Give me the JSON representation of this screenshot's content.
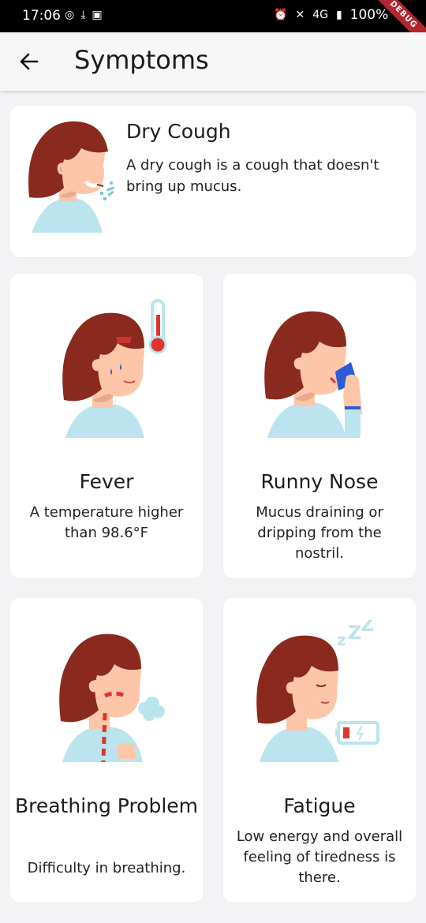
{
  "status_bar": {
    "time": "17:06",
    "battery": "100%",
    "network": "4G",
    "debug_label": "DEBUG"
  },
  "app_bar": {
    "title": "Symptoms",
    "back_icon": "arrow-left-icon"
  },
  "cards": [
    {
      "title": "Dry Cough",
      "description": "A dry cough is a cough that doesn't bring up mucus.",
      "illustration": "woman-coughing-icon"
    },
    {
      "title": "Fever",
      "description": "A temperature higher than 98.6°F",
      "illustration": "woman-fever-thermometer-icon"
    },
    {
      "title": "Runny Nose",
      "description": "Mucus draining or dripping from the nostril.",
      "illustration": "woman-tissue-nose-icon"
    },
    {
      "title": "Breathing Problem",
      "description": "Difficulty in breathing.",
      "illustration": "woman-breathing-icon"
    },
    {
      "title": "Fatigue",
      "description": "Low energy and overall feeling of tiredness is there.",
      "illustration": "woman-sleepy-battery-icon"
    }
  ],
  "colors": {
    "hair": "#8a2a1e",
    "skin": "#fdc6a8",
    "shirt": "#bce4ee",
    "background": "#f3f3f5",
    "card": "#ffffff",
    "debug_banner": "#b3262d"
  }
}
